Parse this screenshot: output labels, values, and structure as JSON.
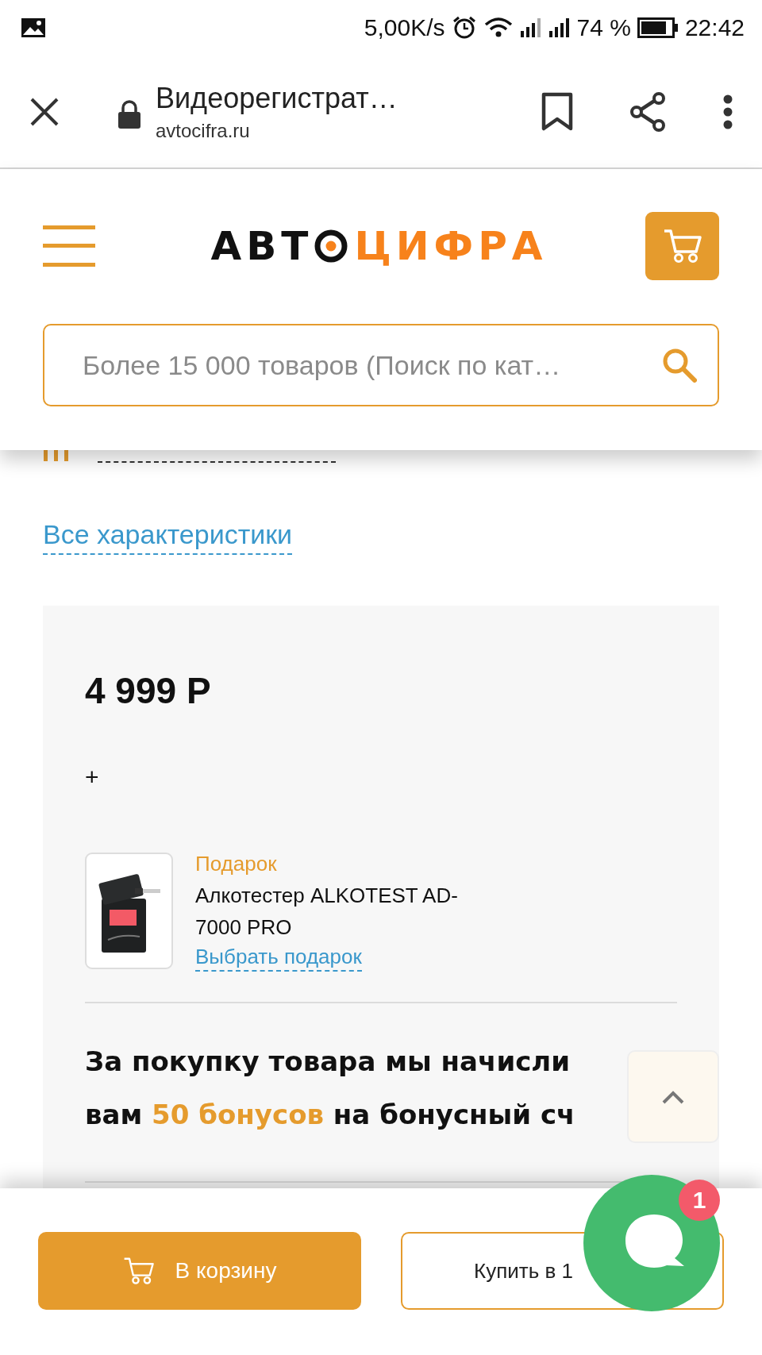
{
  "status_bar": {
    "speed": "5,00K/s",
    "battery": "74 %",
    "time": "22:42"
  },
  "browser_bar": {
    "title": "Видеорегистрат…",
    "url": "avtocifra.ru"
  },
  "site_header": {
    "logo": {
      "part1": "АВТ",
      "part2": "ЦИФРА"
    },
    "search": {
      "placeholder": "Более 15 000 товаров (Поиск по кат…"
    }
  },
  "specs_link": "Все характеристики",
  "offer": {
    "price": "4 999 Р",
    "plus": "+",
    "gift": {
      "label": "Подарок",
      "name": "Алкотестер ALKOTEST AD-7000 PRO",
      "link": "Выбрать подарок"
    },
    "bonus": "За покупку товара мы начисли\nвам **50 бонусов** на бонусный сч"
  },
  "actions": [
    {
      "kind": "primary",
      "label": "В корзину"
    },
    {
      "kind": "outline",
      "label": "Купить в 1"
    }
  ],
  "chat": {
    "badge": "1"
  }
}
